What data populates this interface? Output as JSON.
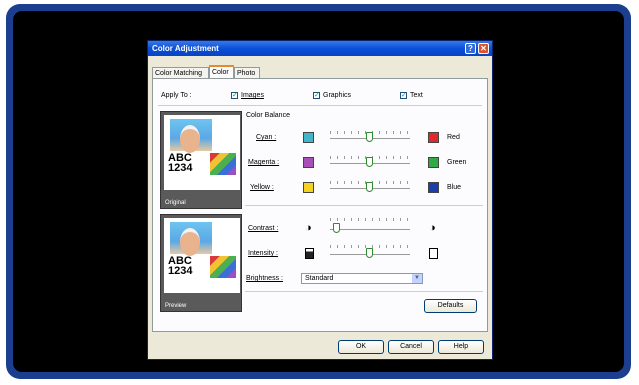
{
  "dialog": {
    "title": "Color Adjustment",
    "help_label": "?",
    "close_label": "✕"
  },
  "tabs": [
    "Color Matching",
    "Color",
    "Photo"
  ],
  "apply_to": {
    "label": "Apply To :",
    "images": "Images",
    "graphics": "Graphics",
    "text": "Text",
    "check_glyph": "✓"
  },
  "previews": {
    "original": "Original",
    "preview": "Preview",
    "abc": "ABC",
    "num": "1234"
  },
  "color_balance": {
    "heading": "Color Balance",
    "rows": [
      {
        "label": "Cyan :",
        "left_color": "#3fb7c8",
        "right_color": "#e02a2a",
        "right_label": "Red",
        "value": 0
      },
      {
        "label": "Magenta :",
        "left_color": "#a650b8",
        "right_color": "#2faa44",
        "right_label": "Green",
        "value": 0
      },
      {
        "label": "Yellow :",
        "left_color": "#f4d21f",
        "right_color": "#1c3ea8",
        "right_label": "Blue",
        "value": 0
      }
    ]
  },
  "contrast": {
    "label": "Contrast :",
    "value": 0
  },
  "intensity": {
    "label": "Intensity :",
    "value": 0
  },
  "brightness": {
    "label": "Brightness :",
    "value": "Standard"
  },
  "buttons": {
    "defaults": "Defaults",
    "ok": "OK",
    "cancel": "Cancel",
    "help": "Help"
  }
}
